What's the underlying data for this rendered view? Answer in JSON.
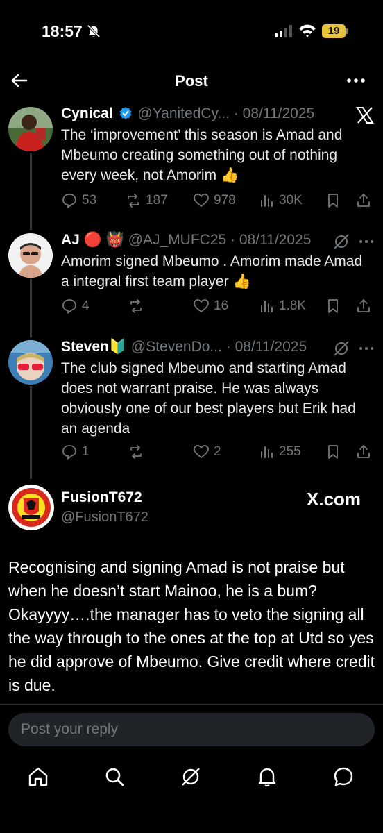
{
  "status_bar": {
    "time": "18:57",
    "battery": "19"
  },
  "header": {
    "title": "Post"
  },
  "thread": [
    {
      "name": "Cynical",
      "handle": "@YanitedCy...",
      "date": "08/11/2025",
      "text": "The ‘improvement’ this season is Amad and Mbeumo creating something out of nothing every week, not Amorim",
      "emoji": "👍",
      "replies": "53",
      "reposts": "187",
      "likes": "978",
      "views": "30K"
    },
    {
      "name": "AJ",
      "name_emoji": "🔴 👹",
      "handle": "@AJ_MUFC25",
      "date": "08/11/2025",
      "text": "Amorim signed Mbeumo . Amorim made Amad a integral first team player",
      "emoji": "👍",
      "replies": "4",
      "reposts": "",
      "likes": "16",
      "views": "1.8K"
    },
    {
      "name": "Steven",
      "name_emoji": "🔰",
      "handle": "@StevenDo...",
      "date": "08/11/2025",
      "text": "The club signed Mbeumo and starting Amad does not warrant praise. He was always obviously one of our best players but Erik had an agenda",
      "replies": "1",
      "reposts": "",
      "likes": "2",
      "views": "255"
    }
  ],
  "main_post": {
    "name": "FusionT672",
    "handle": "@FusionT672",
    "source": "X.com",
    "text": "Recognising and signing Amad is not praise but when he doesn’t start Mainoo, he is a bum? Okayyyy….the manager has to veto the signing all the way through to the ones at the top at Utd so yes he did approve of Mbeumo. Give credit where credit is due."
  },
  "reply": {
    "placeholder": "Post your reply"
  },
  "tabbar": {
    "icons": [
      "home-icon",
      "search-icon",
      "grok-icon",
      "notifications-icon",
      "messages-icon"
    ]
  },
  "colors": {
    "background": "#000000",
    "muted": "#71767b",
    "verified": "#1d9bf0",
    "battery": "#e8c33a"
  }
}
